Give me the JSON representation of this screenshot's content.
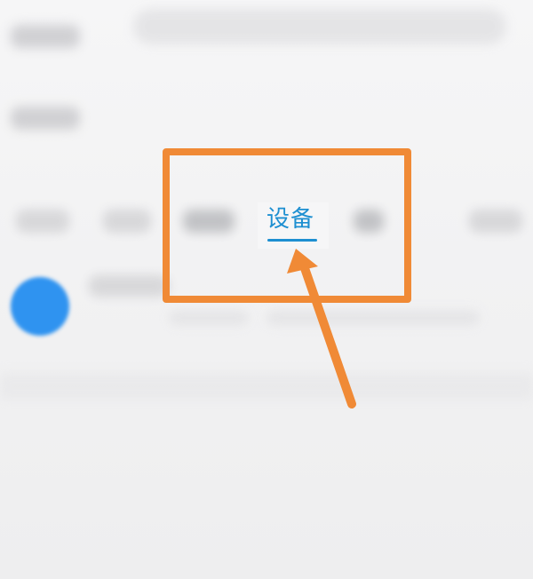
{
  "tabs": {
    "active_label": "设备"
  },
  "colors": {
    "tab_active": "#1d8fd1",
    "annotation": "#f08a36",
    "avatar": "#2f93f0"
  },
  "annotation": {
    "shape": "rectangle-with-arrow",
    "icon": "arrow-pointer-icon"
  }
}
